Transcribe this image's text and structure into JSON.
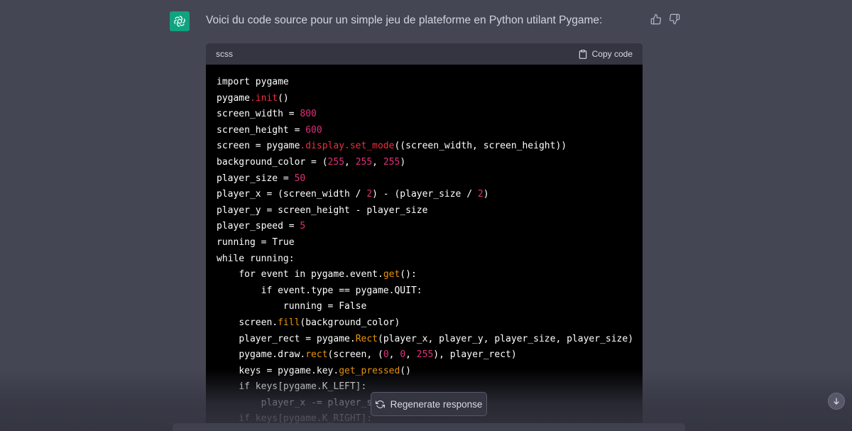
{
  "message": {
    "text": "Voici du code source pour un simple jeu de plateforme en Python utilant Pygame:"
  },
  "code_block": {
    "language": "scss",
    "copy_label": "Copy code",
    "lines": [
      {
        "indent": 0,
        "tokens": [
          {
            "t": "import pygame"
          }
        ]
      },
      {
        "indent": 0,
        "tokens": [
          {
            "t": "pygame"
          },
          {
            "t": ".init",
            "c": "f"
          },
          {
            "t": "()"
          }
        ]
      },
      {
        "indent": 0,
        "tokens": [
          {
            "t": "screen_width = "
          },
          {
            "t": "800",
            "c": "n"
          }
        ]
      },
      {
        "indent": 0,
        "tokens": [
          {
            "t": "screen_height = "
          },
          {
            "t": "600",
            "c": "n"
          }
        ]
      },
      {
        "indent": 0,
        "tokens": [
          {
            "t": "screen = pygame"
          },
          {
            "t": ".display.set_mode",
            "c": "f"
          },
          {
            "t": "((screen_width, screen_height))"
          }
        ]
      },
      {
        "indent": 0,
        "tokens": [
          {
            "t": "background_color = ("
          },
          {
            "t": "255",
            "c": "n"
          },
          {
            "t": ", "
          },
          {
            "t": "255",
            "c": "n"
          },
          {
            "t": ", "
          },
          {
            "t": "255",
            "c": "n"
          },
          {
            "t": ")"
          }
        ]
      },
      {
        "indent": 0,
        "tokens": [
          {
            "t": "player_size = "
          },
          {
            "t": "50",
            "c": "n"
          }
        ]
      },
      {
        "indent": 0,
        "tokens": [
          {
            "t": "player_x = (screen_width / "
          },
          {
            "t": "2",
            "c": "n"
          },
          {
            "t": ") - (player_size / "
          },
          {
            "t": "2",
            "c": "n"
          },
          {
            "t": ")"
          }
        ]
      },
      {
        "indent": 0,
        "tokens": [
          {
            "t": "player_y = screen_height - player_size"
          }
        ]
      },
      {
        "indent": 0,
        "tokens": [
          {
            "t": "player_speed = "
          },
          {
            "t": "5",
            "c": "n"
          }
        ]
      },
      {
        "indent": 0,
        "tokens": [
          {
            "t": "running = True"
          }
        ]
      },
      {
        "indent": 0,
        "tokens": [
          {
            "t": "while running:"
          }
        ]
      },
      {
        "indent": 1,
        "tokens": [
          {
            "t": "for event in pygame.event."
          },
          {
            "t": "get",
            "c": "fn"
          },
          {
            "t": "():"
          }
        ]
      },
      {
        "indent": 2,
        "tokens": [
          {
            "t": "if event.type == pygame.QUIT:"
          }
        ]
      },
      {
        "indent": 3,
        "tokens": [
          {
            "t": "running = False"
          }
        ]
      },
      {
        "indent": 1,
        "tokens": [
          {
            "t": "screen."
          },
          {
            "t": "fill",
            "c": "fn"
          },
          {
            "t": "(background_color)"
          }
        ]
      },
      {
        "indent": 1,
        "tokens": [
          {
            "t": "player_rect = pygame."
          },
          {
            "t": "Rect",
            "c": "fn"
          },
          {
            "t": "(player_x, player_y, player_size, player_size)"
          }
        ]
      },
      {
        "indent": 1,
        "tokens": [
          {
            "t": "pygame.draw."
          },
          {
            "t": "rect",
            "c": "fn"
          },
          {
            "t": "(screen, ("
          },
          {
            "t": "0",
            "c": "n"
          },
          {
            "t": ", "
          },
          {
            "t": "0",
            "c": "n"
          },
          {
            "t": ", "
          },
          {
            "t": "255",
            "c": "n"
          },
          {
            "t": "), player_rect)"
          }
        ]
      },
      {
        "indent": 1,
        "tokens": [
          {
            "t": "keys = pygame.key."
          },
          {
            "t": "get_pressed",
            "c": "fn"
          },
          {
            "t": "()"
          }
        ]
      },
      {
        "indent": 1,
        "tokens": [
          {
            "t": "if keys[pygame.K_LEFT]:"
          }
        ]
      },
      {
        "indent": 2,
        "tokens": [
          {
            "t": "player_x -= player_speed"
          }
        ]
      },
      {
        "indent": 1,
        "tokens": [
          {
            "t": "if keys[pygame.K_RIGHT]:"
          }
        ]
      }
    ]
  },
  "regenerate": {
    "label": "Regenerate response"
  },
  "icons": {
    "avatar": "openai-logo-icon",
    "thumb_up": "thumbs-up-icon",
    "thumb_down": "thumbs-down-icon",
    "copy": "clipboard-icon",
    "regenerate": "refresh-icon",
    "scroll": "arrow-down-icon"
  },
  "colors": {
    "background": "#444654",
    "code_bg": "#000000",
    "avatar": "#10a37f",
    "number": "#df3079",
    "attr": "#f22c3d",
    "func": "#e9950c"
  }
}
